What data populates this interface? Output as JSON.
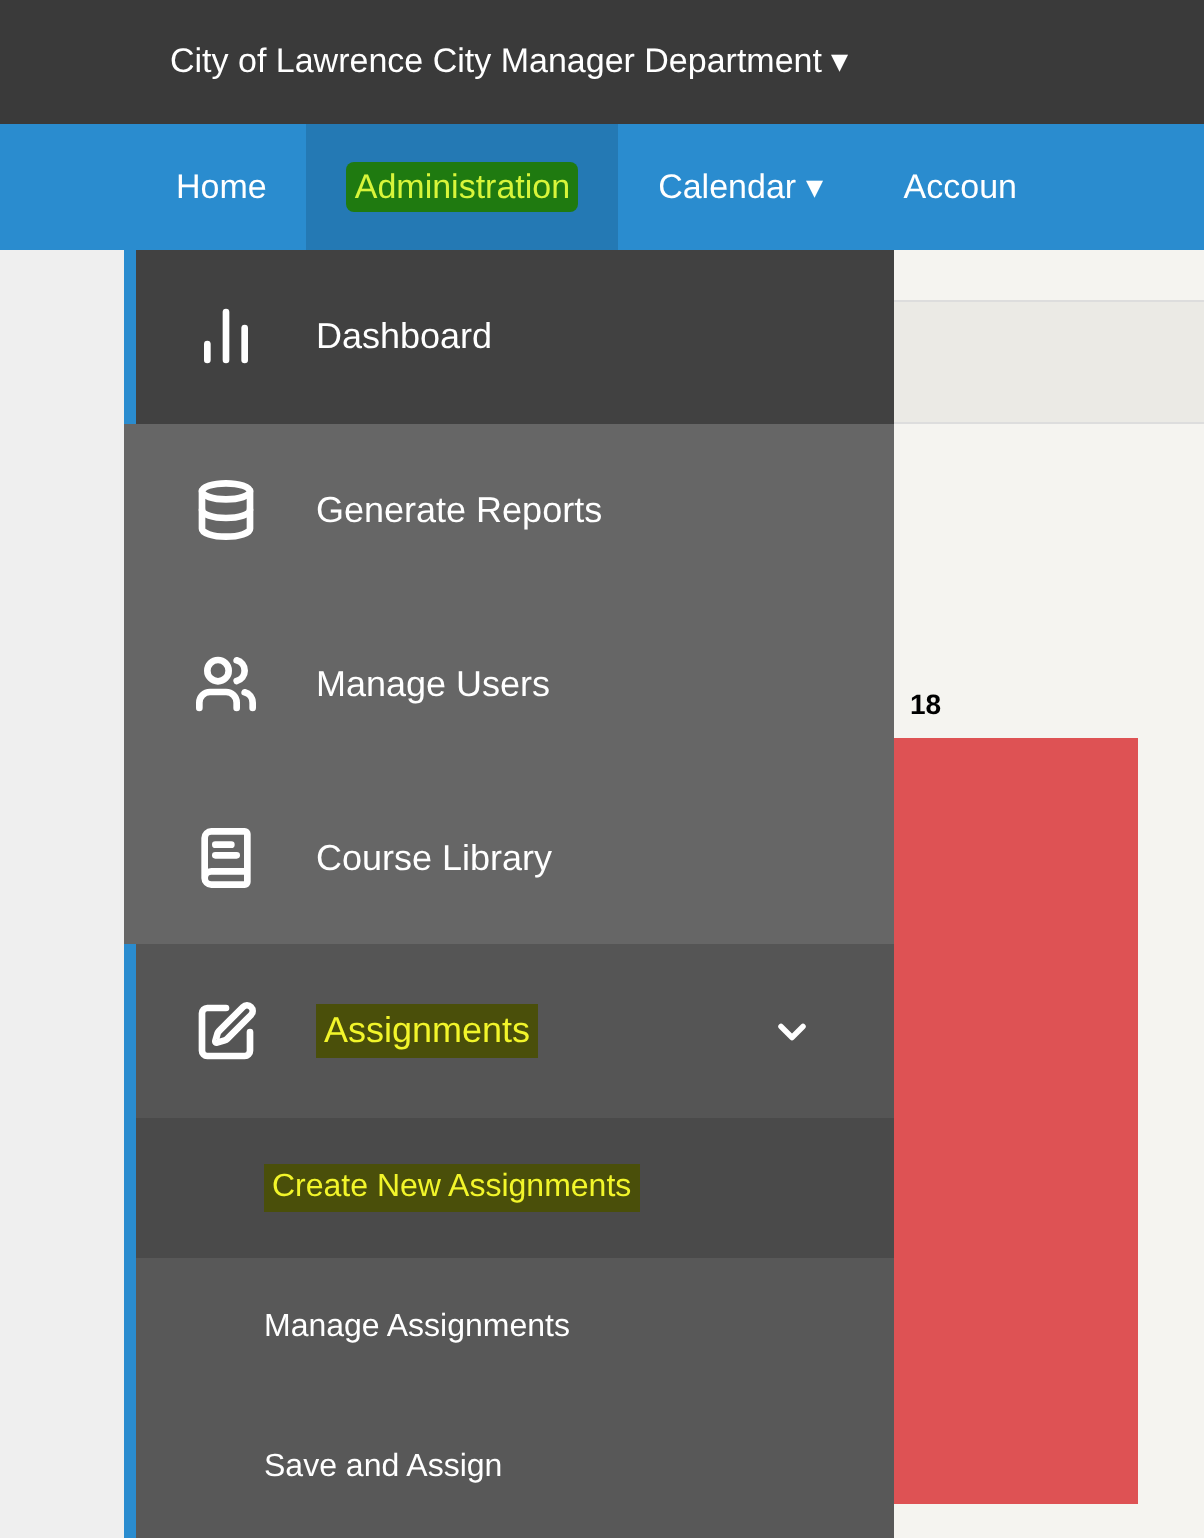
{
  "org_switcher": {
    "label": "City of Lawrence City Manager Department ▾"
  },
  "nav": [
    {
      "label": "Home",
      "selected": false,
      "highlighted": false
    },
    {
      "label": "Administration",
      "selected": true,
      "highlighted": true
    },
    {
      "label": "Calendar ▾",
      "selected": false,
      "highlighted": false
    },
    {
      "label": "Accoun",
      "selected": false,
      "highlighted": false
    }
  ],
  "menu": [
    {
      "label": "Dashboard",
      "selected": true,
      "highlighted": false
    },
    {
      "label": "Generate Reports",
      "selected": false,
      "highlighted": false
    },
    {
      "label": "Manage Users",
      "selected": false,
      "highlighted": false
    },
    {
      "label": "Course Library",
      "selected": false,
      "highlighted": false
    },
    {
      "label": "Assignments",
      "selected": false,
      "highlighted": true,
      "expanded": true,
      "children": [
        {
          "label": "Create New Assignments",
          "selected": true,
          "highlighted": true
        },
        {
          "label": "Manage Assignments",
          "selected": false,
          "highlighted": false
        },
        {
          "label": "Save and Assign",
          "selected": false,
          "highlighted": false
        }
      ]
    }
  ],
  "chart": {
    "value_label": "18"
  }
}
